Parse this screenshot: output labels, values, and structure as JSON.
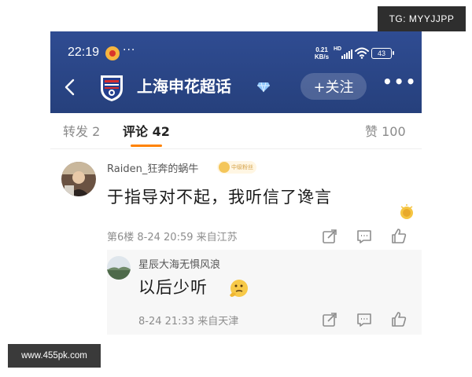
{
  "watermarks": {
    "telegram": "TG: MYYJJPP",
    "site": "www.455pk.com"
  },
  "status_bar": {
    "time": "22:19",
    "more": "···",
    "net_speed_value": "0.21",
    "net_speed_unit": "KB/s",
    "network": "HD",
    "battery": "43"
  },
  "header": {
    "title": "上海申花超话",
    "follow_label": "+关注",
    "menu": "•••",
    "colors": {
      "bar": "#2f4c92",
      "text": "#ffffff"
    }
  },
  "tabs": [
    {
      "label": "转发 2"
    },
    {
      "label": "评论 42",
      "active": true
    },
    {
      "label": "赞 100"
    }
  ],
  "tab_accent": "#ff8200",
  "comment": {
    "username": "Raiden_狂奔的蜗牛",
    "fan_badge": "中级粉丝",
    "text": "于指导对不起，我听信了谗言",
    "meta": "第6楼 8-24 20:59 来自江苏",
    "icons": [
      "share-icon",
      "comment-icon",
      "like-icon"
    ]
  },
  "reply": {
    "username": "星辰大海无惧风浪",
    "text": "以后少听",
    "meta": "8-24 21:33 来自天津",
    "icons": [
      "share-icon",
      "comment-icon",
      "like-icon"
    ]
  }
}
